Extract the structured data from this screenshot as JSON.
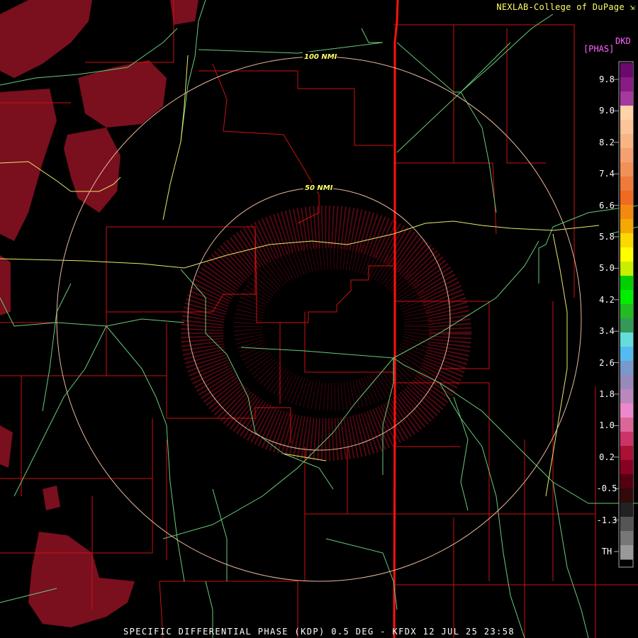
{
  "credit": "NEXLAB-College of DuPage",
  "bottom_title": "SPECIFIC DIFFERENTIAL PHASE (KDP) 0.5 DEG - KFDX 12 JUL 25 23:58",
  "rings": [
    {
      "label": "50 NMI"
    },
    {
      "label": "100 NMI"
    }
  ],
  "colorbar": {
    "product": "DKD",
    "units": "[PHAS]",
    "ticks": [
      "9.8",
      "9.0",
      "8.2",
      "7.4",
      "6.6",
      "5.8",
      "5.0",
      "4.2",
      "3.4",
      "2.6",
      "1.8",
      "1.0",
      "0.2",
      "-0.5",
      "-1.3",
      "TH"
    ],
    "colors": [
      "#6a0a6e",
      "#8a1a86",
      "#a43a9c",
      "#ffd2a8",
      "#fcc498",
      "#f8b484",
      "#f5a070",
      "#f29058",
      "#f07a3a",
      "#f06a20",
      "#f28a10",
      "#f5a800",
      "#fcd800",
      "#ffff00",
      "#c8ee00",
      "#00d000",
      "#00ee00",
      "#22bb22",
      "#339955",
      "#66dddd",
      "#55bbee",
      "#7799cc",
      "#9988bb",
      "#bb88bb",
      "#ee88cc",
      "#dd6699",
      "#cc3366",
      "#aa1133",
      "#880022",
      "#550011",
      "#330a0a",
      "#222222",
      "#555555",
      "#777777",
      "#999999"
    ]
  }
}
